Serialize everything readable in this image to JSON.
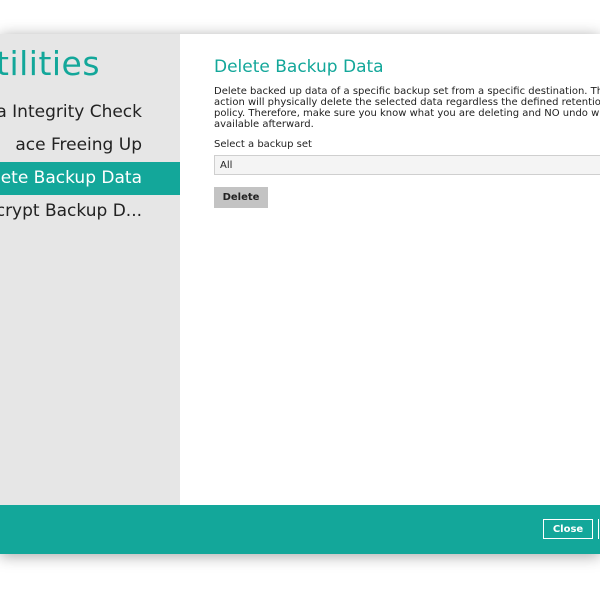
{
  "sidebar": {
    "title": "tilities",
    "items": [
      {
        "label": "ta Integrity Check"
      },
      {
        "label": "ace Freeing Up"
      },
      {
        "label": "lete Backup Data"
      },
      {
        "label": "crypt Backup D..."
      }
    ],
    "active_index": 2
  },
  "main": {
    "title": "Delete Backup Data",
    "description": "Delete backed up data of a specific backup set from a specific destination. This action will physically delete the selected data regardless the defined retention policy. Therefore, make sure you know what you are deleting and NO undo will be available afterward.",
    "select_label": "Select a backup set",
    "select_value": "All",
    "delete_label": "Delete"
  },
  "footer": {
    "close_label": "Close"
  },
  "colors": {
    "accent": "#13a79a",
    "sidebar_bg": "#e6e6e6",
    "button_gray": "#c3c3c3"
  }
}
